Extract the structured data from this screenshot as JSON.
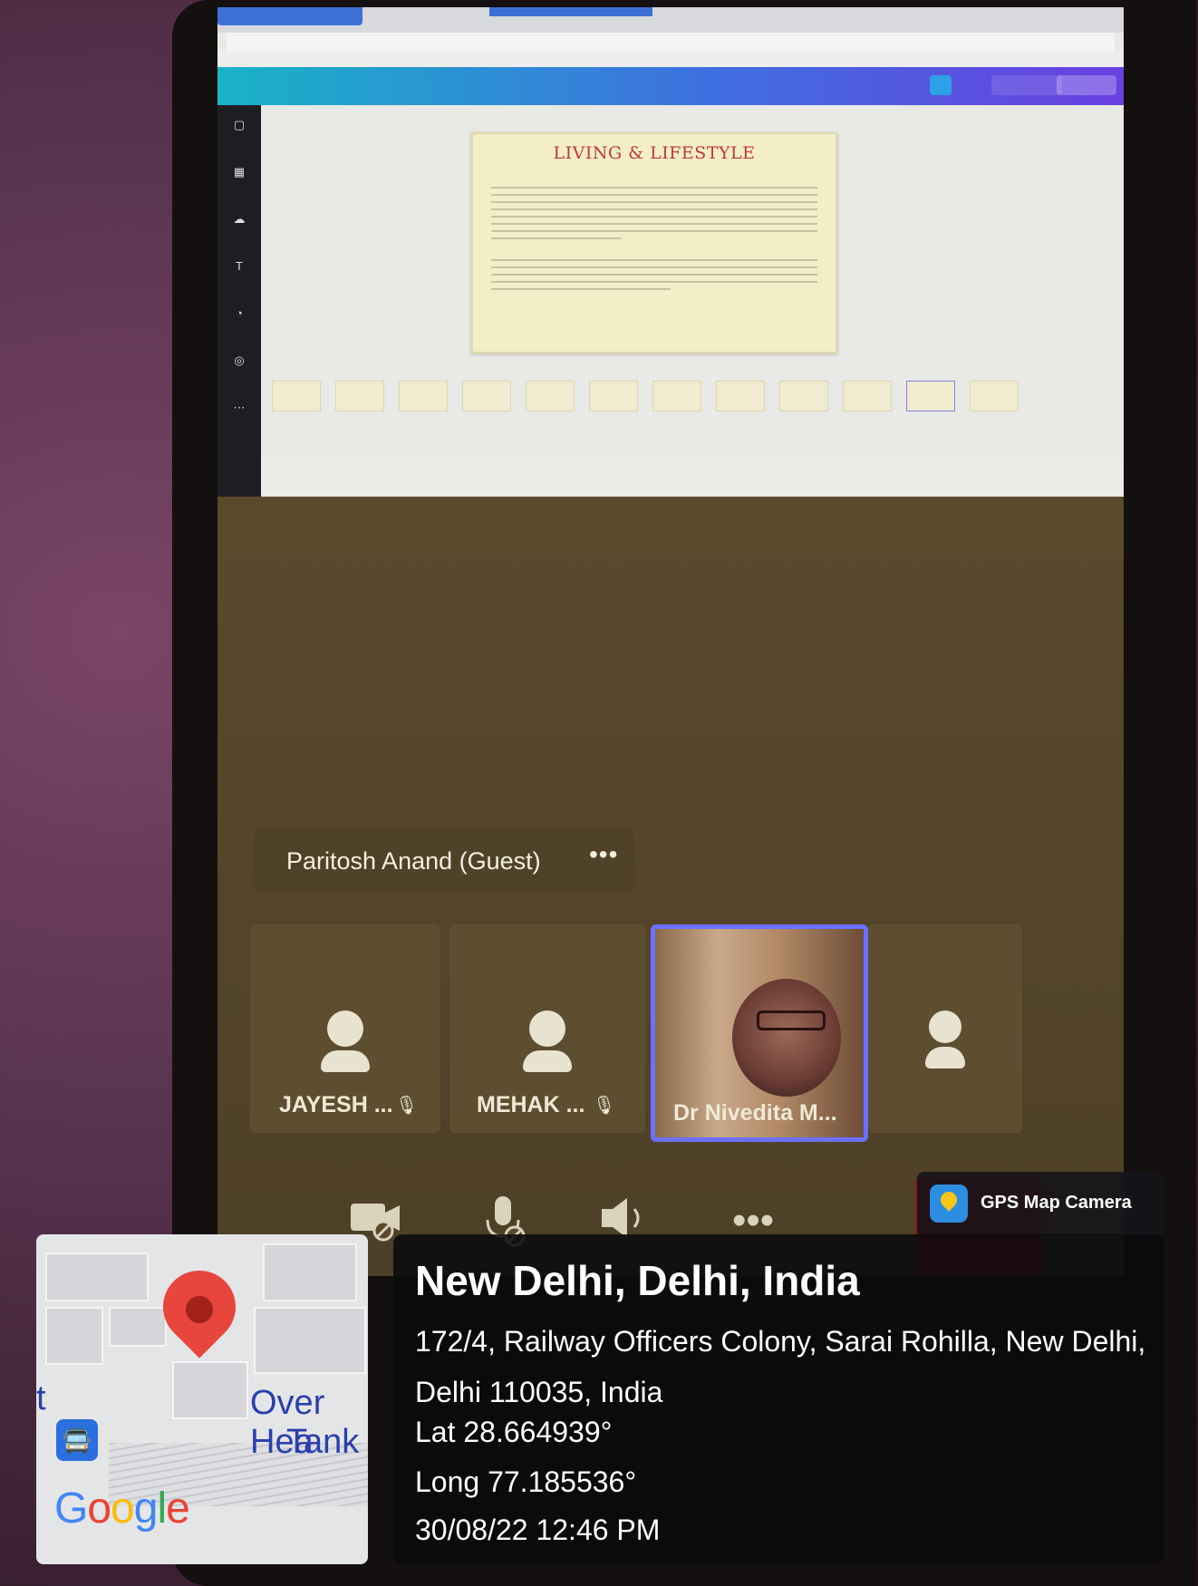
{
  "editor": {
    "slide_title": "LIVING & LIFESTYLE"
  },
  "meeting": {
    "speaker": "Paritosh Anand (Guest)",
    "speaker_more": "•••",
    "participants": [
      {
        "name": "JAYESH ..."
      },
      {
        "name": "MEHAK ..."
      },
      {
        "name": "Dr Nivedita M..."
      }
    ],
    "controls": {
      "camera": "camera-off-icon",
      "mic": "mic-off-icon",
      "speaker": "speaker-icon",
      "more": "•••"
    },
    "accent_color": "#6a71ff",
    "end_color": "#8c1c16"
  },
  "gps": {
    "app_name": "GPS Map Camera",
    "city": "New Delhi, Delhi, India",
    "address": "172/4, Railway Officers Colony, Sarai Rohilla, New Delhi, Delhi 110035, India",
    "lat": "Lat 28.664939°",
    "long": "Long 77.185536°",
    "datetime": "30/08/22 12:46 PM",
    "map": {
      "label_partial_left": "t",
      "label_line1": "Over Hea",
      "label_line2": "Tank",
      "provider": "Google"
    }
  }
}
